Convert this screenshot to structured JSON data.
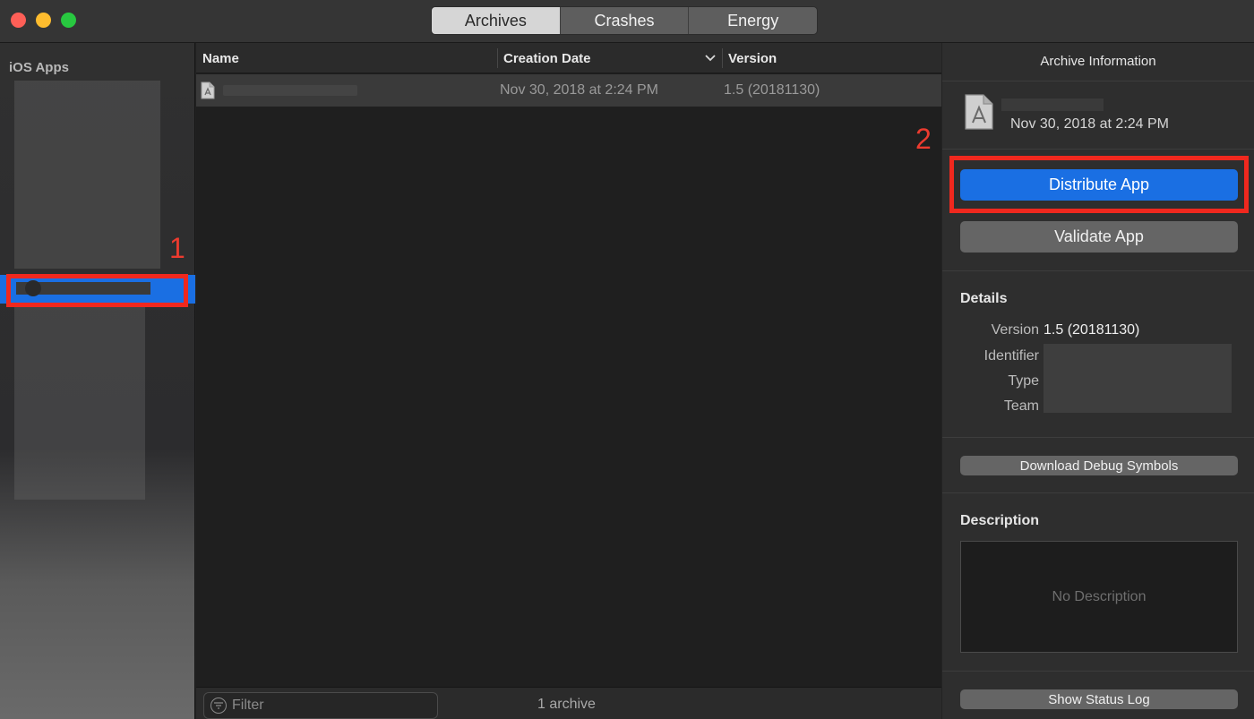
{
  "window": {
    "tabs": [
      {
        "label": "Archives",
        "active": true
      },
      {
        "label": "Crashes",
        "active": false
      },
      {
        "label": "Energy",
        "active": false
      }
    ]
  },
  "sidebar": {
    "header": "iOS Apps",
    "annotation_number": "1"
  },
  "list": {
    "columns": {
      "name": "Name",
      "creation_date": "Creation Date",
      "version": "Version"
    },
    "rows": [
      {
        "creation_date": "Nov 30, 2018 at 2:24 PM",
        "version": "1.5 (20181130)"
      }
    ],
    "footer": {
      "filter_placeholder": "Filter",
      "archive_count": "1 archive"
    }
  },
  "inspector": {
    "title": "Archive Information",
    "archive_date": "Nov 30, 2018 at 2:24 PM",
    "annotation_number": "2",
    "distribute_label": "Distribute App",
    "validate_label": "Validate App",
    "details": {
      "title": "Details",
      "version_label": "Version",
      "version_value": "1.5 (20181130)",
      "identifier_label": "Identifier",
      "type_label": "Type",
      "team_label": "Team"
    },
    "download_debug_label": "Download Debug Symbols",
    "description": {
      "title": "Description",
      "placeholder": "No Description"
    },
    "status_log_label": "Show Status Log"
  },
  "colors": {
    "accent": "#1a6fe3",
    "annotation": "#f0281e"
  }
}
